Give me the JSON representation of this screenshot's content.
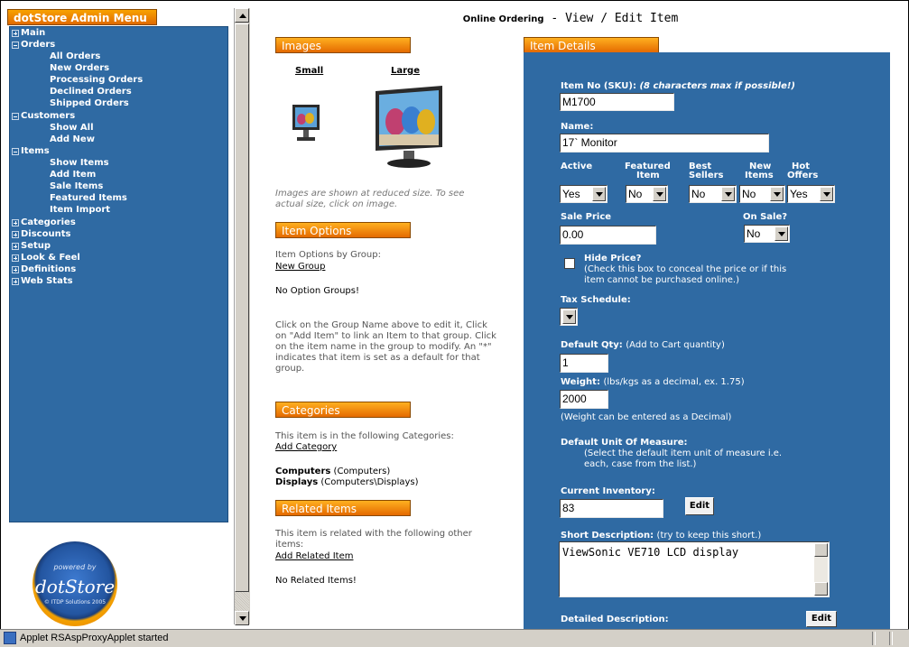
{
  "sidebar": {
    "title": "dotStore Admin Menu",
    "items": [
      {
        "label": "Main",
        "expander": "plus"
      },
      {
        "label": "Orders",
        "expander": "minus"
      },
      {
        "label": "All Orders"
      },
      {
        "label": "New Orders"
      },
      {
        "label": "Processing Orders"
      },
      {
        "label": "Declined Orders"
      },
      {
        "label": "Shipped Orders"
      },
      {
        "label": "Customers",
        "expander": "minus"
      },
      {
        "label": "Show All"
      },
      {
        "label": "Add New"
      },
      {
        "label": "Items",
        "expander": "minus"
      },
      {
        "label": "Show Items"
      },
      {
        "label": "Add Item"
      },
      {
        "label": "Sale Items"
      },
      {
        "label": "Featured Items"
      },
      {
        "label": "Item Import"
      },
      {
        "label": "Categories",
        "expander": "plus"
      },
      {
        "label": "Discounts",
        "expander": "plus"
      },
      {
        "label": "Setup",
        "expander": "plus"
      },
      {
        "label": "Look & Feel",
        "expander": "plus"
      },
      {
        "label": "Definitions",
        "expander": "plus"
      },
      {
        "label": "Web Stats",
        "expander": "plus"
      }
    ],
    "logo": {
      "powered_by": "powered by",
      "brand": "dotStore",
      "copyright": "© ITDP Solutions 2005"
    }
  },
  "header": {
    "app": "Online Ordering",
    "separator": " - ",
    "title": "View / Edit Item"
  },
  "images": {
    "tab": "Images",
    "small_label": "Small",
    "large_label": "Large",
    "note": "Images are shown at reduced size.  To see actual size, click on image."
  },
  "item_options": {
    "tab": "Item Options",
    "by_group": "Item Options by Group:",
    "new_group": "New Group",
    "none": "No Option Groups!",
    "help": "Click on the Group Name above to edit it, Click on \"Add Item\" to link an Item to that group. Click on the item name in the group to modify.  An \"*\" indicates that item is set as a default for that group."
  },
  "categories": {
    "tab": "Categories",
    "intro": "This item is in the following Categories:",
    "add": "Add Category",
    "list": [
      {
        "name": "Computers",
        "path": "(Computers)"
      },
      {
        "name": "Displays",
        "path": "(Computers\\Displays)"
      }
    ]
  },
  "related": {
    "tab": "Related Items",
    "intro": "This item is related with the following other items:",
    "add": "Add Related Item",
    "none": "No Related Items!"
  },
  "details": {
    "tab": "Item Details",
    "sku_label": "Item No (SKU):",
    "sku_hint": "(8 characters max if possible!)",
    "sku_value": "M1700",
    "name_label": "Name:",
    "name_value": "17` Monitor",
    "active_label": "Active",
    "featured_label_1": "Featured",
    "featured_label_2": "Item",
    "best_label_1": "Best",
    "best_label_2": "Sellers",
    "new_label_1": "New",
    "new_label_2": "Items",
    "hot_label_1": "Hot",
    "hot_label_2": "Offers",
    "active_value": "Yes",
    "featured_value": "No",
    "best_value": "No",
    "new_value": "No",
    "hot_value": "Yes",
    "sale_price_label": "Sale Price",
    "sale_price_value": "0.00",
    "on_sale_label": "On Sale?",
    "on_sale_value": "No",
    "hide_price_label": "Hide Price?",
    "hide_price_hint_1": "(Check this box to conceal the price or if this",
    "hide_price_hint_2": "item cannot be purchased online.)",
    "tax_label": "Tax Schedule:",
    "tax_value": "",
    "qty_label": "Default Qty:",
    "qty_hint": "(Add to Cart quantity)",
    "qty_value": "1",
    "weight_label": "Weight:",
    "weight_hint": "(lbs/kgs as a decimal, ex. 1.75)",
    "weight_value": "2000",
    "weight_note": "(Weight can be entered as a Decimal)",
    "uom_label": "Default Unit Of Measure:",
    "uom_hint_1": "(Select the default item unit of measure i.e.",
    "uom_hint_2": "each, case from the list.)",
    "inventory_label": "Current Inventory:",
    "inventory_value": "83",
    "edit_label": "Edit",
    "short_desc_label": "Short Description:",
    "short_desc_hint": "(try to keep this short.)",
    "short_desc_value": "ViewSonic VE710 LCD display",
    "detailed_desc_label": "Detailed Description:"
  },
  "status": {
    "text": "Applet RSAspProxyApplet started"
  }
}
